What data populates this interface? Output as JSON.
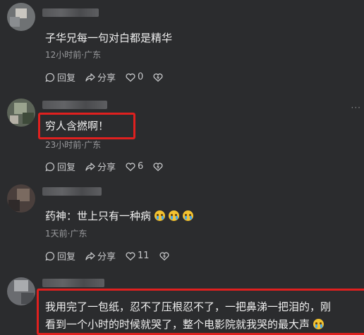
{
  "comments": [
    {
      "text": "子华兄每一句对白都是精华",
      "meta": "12小时前·广东",
      "reply_label": "回复",
      "share_label": "分享",
      "likes": "0",
      "likes_hidden": false
    },
    {
      "text": "穷人含撚啊！",
      "meta": "23小时前·广东",
      "reply_label": "回复",
      "share_label": "分享",
      "likes": "6"
    },
    {
      "text": "药神：世上只有一种病",
      "meta": "1天前·广东",
      "reply_label": "回复",
      "share_label": "分享",
      "likes": "11"
    },
    {
      "text_line1": "我用完了一包纸，忍不了压根忍不了，一把鼻涕一把泪的，刚",
      "text_line2": "看到一个小时的时候就哭了，整个电影院就我哭的最大声"
    }
  ],
  "icons": [
    "reply-icon",
    "share-icon",
    "like-icon",
    "dislike-icon",
    "crying-emoji-icon",
    "more-icon"
  ],
  "colors": {
    "background": "#2b2c2e",
    "highlight": "#e0201f",
    "meta": "#9a9b9e"
  }
}
